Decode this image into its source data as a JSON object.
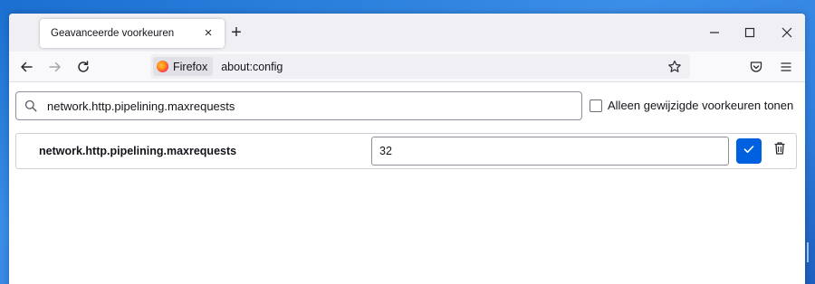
{
  "tab": {
    "title": "Geavanceerde voorkeuren",
    "close": "×"
  },
  "newtab": {
    "label": "+"
  },
  "window_controls": {
    "minimize": "minimize-icon",
    "maximize": "maximize-icon",
    "close": "close-icon"
  },
  "navbar": {
    "back": "back-arrow-icon",
    "forward": "forward-arrow-icon",
    "reload": "reload-icon",
    "identity_label": "Firefox",
    "url": "about:config",
    "bookmark": "star-icon",
    "pocket": "pocket-icon",
    "menu": "hamburger-menu-icon"
  },
  "search": {
    "value": "network.http.pipelining.maxrequests",
    "icon": "search-icon"
  },
  "filter": {
    "label": "Alleen gewijzigde voorkeuren tonen",
    "checked": false
  },
  "preference": {
    "name": "network.http.pipelining.maxrequests",
    "value": "32",
    "save_icon": "checkmark-icon",
    "delete_icon": "trash-icon",
    "accent": "#0061e0"
  }
}
